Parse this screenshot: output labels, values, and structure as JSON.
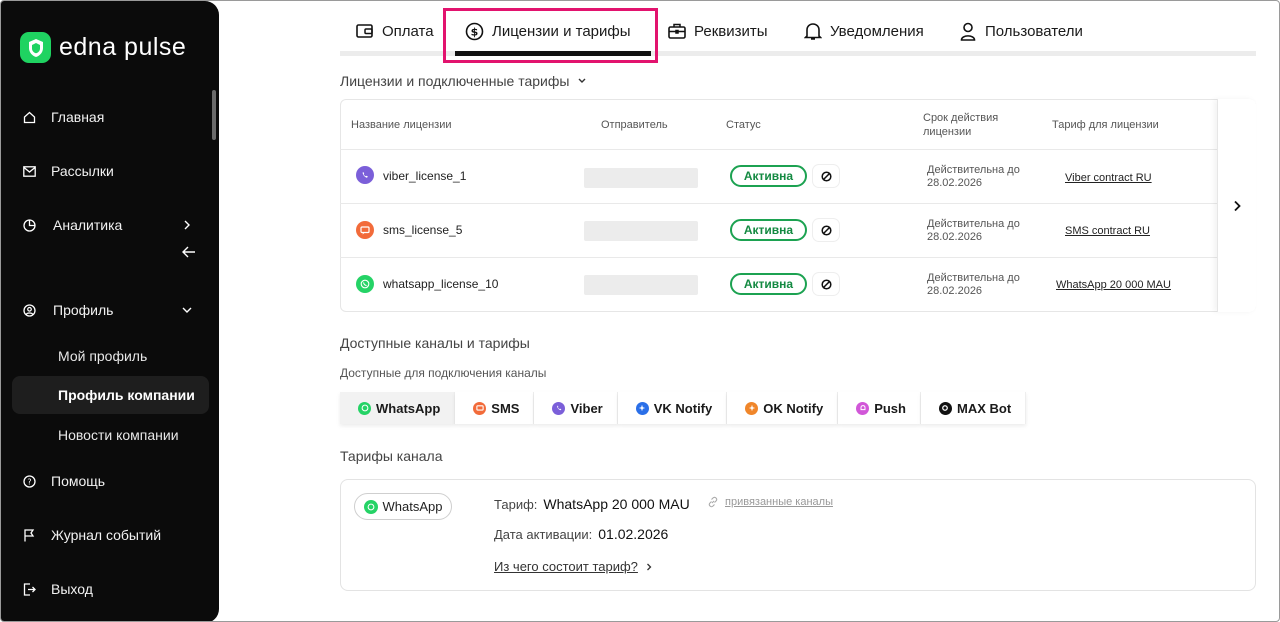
{
  "app": {
    "logo_text": "edna pulse",
    "brand_color": "#1fd361"
  },
  "sidebar": {
    "items": [
      {
        "label": "Главная",
        "icon": "home-icon"
      },
      {
        "label": "Рассылки",
        "icon": "mail-icon"
      },
      {
        "label": "Аналитика",
        "icon": "chart-icon"
      },
      {
        "label": "Профиль",
        "icon": "user-icon"
      },
      {
        "label": "Помощь",
        "icon": "help-icon"
      },
      {
        "label": "Журнал событий",
        "icon": "flag-icon"
      },
      {
        "label": "Выход",
        "icon": "logout-icon"
      }
    ],
    "profile_sub": [
      {
        "label": "Мой профиль"
      },
      {
        "label": "Профиль компании",
        "active": true
      },
      {
        "label": "Новости компании"
      }
    ]
  },
  "tabs": [
    {
      "label": "Оплата",
      "icon": "wallet-icon"
    },
    {
      "label": "Лицензии и тарифы",
      "icon": "dollar-circle-icon",
      "active": true
    },
    {
      "label": "Реквизиты",
      "icon": "briefcase-icon"
    },
    {
      "label": "Уведомления",
      "icon": "bell-icon"
    },
    {
      "label": "Пользователи",
      "icon": "person-icon"
    }
  ],
  "licenses": {
    "title": "Лицензии и подключенные тарифы",
    "columns": [
      "Название лицензии",
      "Отправитель",
      "Статус",
      "Срок действия лицензии",
      "Тариф для лицензии"
    ],
    "rows": [
      {
        "name": "viber_license_1",
        "channel": "viber",
        "status": "Активна",
        "valid_label": "Действительна до",
        "valid_date": "28.02.2026",
        "tariff": "Viber contract RU"
      },
      {
        "name": "sms_license_5",
        "channel": "sms",
        "status": "Активна",
        "valid_label": "Действительна до",
        "valid_date": "28.02.2026",
        "tariff": "SMS contract RU"
      },
      {
        "name": "whatsapp_license_10",
        "channel": "whatsapp",
        "status": "Активна",
        "valid_label": "Действительна до",
        "valid_date": "28.02.2026",
        "tariff": "WhatsApp 20 000 MAU"
      }
    ]
  },
  "available": {
    "title": "Доступные каналы и тарифы",
    "subtitle": "Доступные для подключения каналы",
    "channels": [
      {
        "label": "WhatsApp",
        "color": "#25d366",
        "active": true
      },
      {
        "label": "SMS",
        "color": "#f26b3a"
      },
      {
        "label": "Viber",
        "color": "#7b5fd9"
      },
      {
        "label": "VK Notify",
        "color": "#2a6fe8"
      },
      {
        "label": "OK Notify",
        "color": "#f0862a"
      },
      {
        "label": "Push",
        "color": "#d157d8"
      },
      {
        "label": "MAX Bot",
        "color": "#111111"
      }
    ]
  },
  "channel_tariffs": {
    "title": "Тарифы канала",
    "chip": "WhatsApp",
    "tariff_label": "Тариф:",
    "tariff_value": "WhatsApp 20 000 MAU",
    "linked_label": "привязанные каналы",
    "activation_label": "Дата активации:",
    "activation_value": "01.02.2026",
    "composition_link": "Из чего состоит тариф?"
  }
}
